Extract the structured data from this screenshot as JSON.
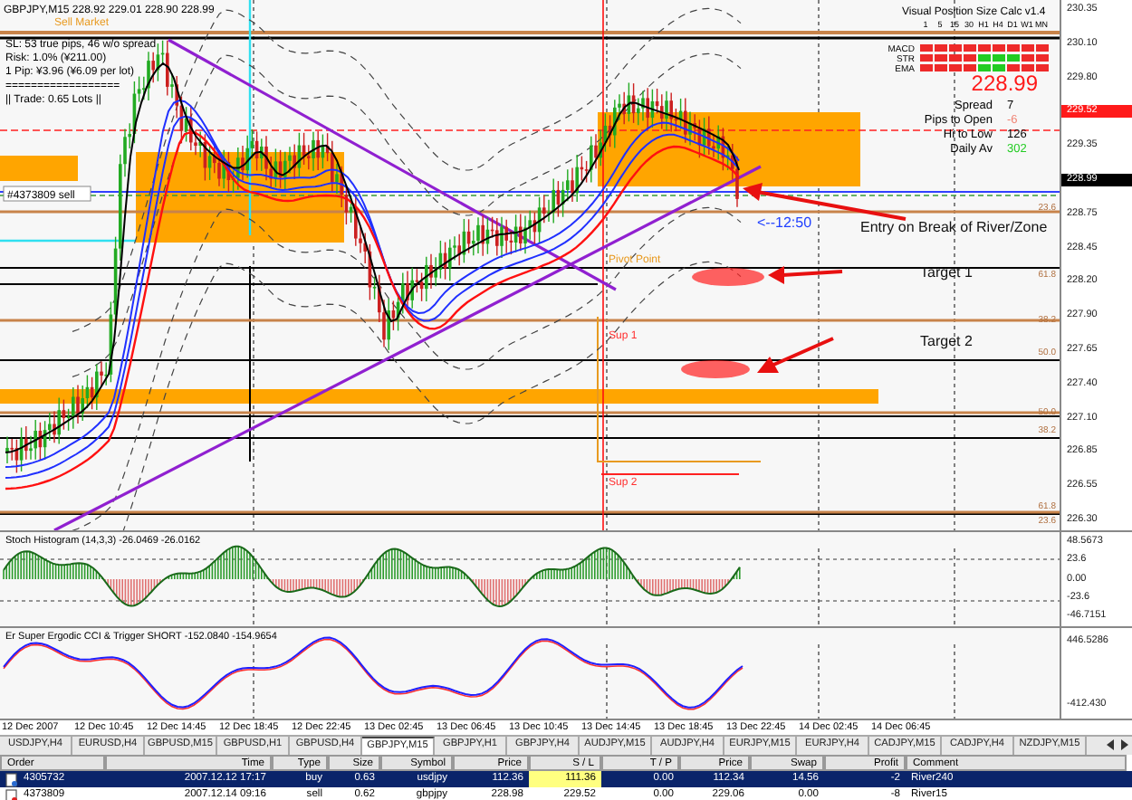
{
  "chart": {
    "title": "GBPJPY,M15  228.92 229.01 228.90 228.99",
    "order_label": "Sell Market",
    "info_lines": [
      "SL:    53 true pips, 46 w/o spread",
      "Risk:  1.0% (¥211.00)",
      "1 Pip:  ¥3.96 (¥6.09 per lot)",
      "==================",
      "||  Trade:  0.65 Lots  ||"
    ],
    "order_line_label": "#4373809 sell",
    "annotations": [
      {
        "kind": "time",
        "text": "<--12:50"
      },
      {
        "kind": "note",
        "text": "Entry on Break of River/Zone"
      },
      {
        "kind": "note",
        "text": "Target 1"
      },
      {
        "kind": "note",
        "text": "Target 2"
      },
      {
        "kind": "pivot",
        "text": "Pivot Point"
      },
      {
        "kind": "support",
        "text": "Sup 1"
      },
      {
        "kind": "support",
        "text": "Sup 2"
      }
    ],
    "fib_labels": [
      "23.6",
      "61.8",
      "38.2",
      "50.0",
      "50.0",
      "38.2",
      "61.8",
      "23.6"
    ],
    "price_axis": [
      {
        "text": "230.35",
        "kind": "tick"
      },
      {
        "text": "230.10",
        "kind": "tick"
      },
      {
        "text": "229.80",
        "kind": "tick"
      },
      {
        "text": "229.52",
        "kind": "alert"
      },
      {
        "text": "229.35",
        "kind": "tick"
      },
      {
        "text": "228.99",
        "kind": "current"
      },
      {
        "text": "228.75",
        "kind": "tick"
      },
      {
        "text": "228.45",
        "kind": "tick"
      },
      {
        "text": "228.20",
        "kind": "tick"
      },
      {
        "text": "227.90",
        "kind": "tick"
      },
      {
        "text": "227.65",
        "kind": "tick"
      },
      {
        "text": "227.40",
        "kind": "tick"
      },
      {
        "text": "227.10",
        "kind": "tick"
      },
      {
        "text": "226.85",
        "kind": "tick"
      },
      {
        "text": "226.55",
        "kind": "tick"
      },
      {
        "text": "226.30",
        "kind": "tick"
      }
    ]
  },
  "calc_panel": {
    "title": "Visual Position Size Calc v1.4",
    "timeframes": [
      "1",
      "5",
      "15",
      "30",
      "H1",
      "H4",
      "D1",
      "W1",
      "MN"
    ],
    "signals": [
      {
        "name": "MACD",
        "cells": [
          false,
          false,
          false,
          false,
          false,
          false,
          false,
          false,
          false
        ]
      },
      {
        "name": "STR",
        "cells": [
          false,
          false,
          false,
          false,
          true,
          true,
          true,
          false,
          false
        ]
      },
      {
        "name": "EMA",
        "cells": [
          false,
          false,
          false,
          false,
          true,
          true,
          false,
          false,
          false
        ]
      }
    ],
    "price": "228.99",
    "stats": [
      {
        "label": "Spread",
        "value": "7",
        "color": "#000000"
      },
      {
        "label": "Pips to Open",
        "value": "-6",
        "color": "#f08070"
      },
      {
        "label": "Hi to Low",
        "value": "126",
        "color": "#000000"
      },
      {
        "label": "Daily Av",
        "value": "302",
        "color": "#22cc22"
      }
    ]
  },
  "stoch": {
    "title": "Stoch Histogram (14,3,3) -26.0469 -26.0162",
    "axis": [
      "48.5673",
      "23.6",
      "0.00",
      "-23.6",
      "-46.7151"
    ]
  },
  "cci": {
    "title": "Er Super Ergodic CCI & Trigger SHORT -152.0840 -154.9654",
    "axis": [
      "446.5286",
      "-412.430"
    ]
  },
  "time_axis": [
    "12 Dec 2007",
    "12 Dec 10:45",
    "12 Dec 14:45",
    "12 Dec 18:45",
    "12 Dec 22:45",
    "13 Dec 02:45",
    "13 Dec 06:45",
    "13 Dec 10:45",
    "13 Dec 14:45",
    "13 Dec 18:45",
    "13 Dec 22:45",
    "14 Dec 02:45",
    "14 Dec 06:45"
  ],
  "tabs": [
    {
      "label": "USDJPY,H4",
      "selected": false
    },
    {
      "label": "EURUSD,H4",
      "selected": false
    },
    {
      "label": "GBPUSD,M15",
      "selected": false
    },
    {
      "label": "GBPUSD,H1",
      "selected": false
    },
    {
      "label": "GBPUSD,H4",
      "selected": false
    },
    {
      "label": "GBPJPY,M15",
      "selected": true
    },
    {
      "label": "GBPJPY,H1",
      "selected": false
    },
    {
      "label": "GBPJPY,H4",
      "selected": false
    },
    {
      "label": "AUDJPY,M15",
      "selected": false
    },
    {
      "label": "AUDJPY,H4",
      "selected": false
    },
    {
      "label": "EURJPY,M15",
      "selected": false
    },
    {
      "label": "EURJPY,H4",
      "selected": false
    },
    {
      "label": "CADJPY,M15",
      "selected": false
    },
    {
      "label": "CADJPY,H4",
      "selected": false
    },
    {
      "label": "NZDJPY,M15",
      "selected": false
    }
  ],
  "table": {
    "columns": [
      "Order",
      "Time",
      "Type",
      "Size",
      "Symbol",
      "Price",
      "S / L",
      "T / P",
      "Price",
      "Swap",
      "Profit",
      "Comment"
    ],
    "rows": [
      {
        "selected": true,
        "sl_highlighted": true,
        "cells": [
          "4305732",
          "2007.12.12 17:17",
          "buy",
          "0.63",
          "usdjpy",
          "112.36",
          "111.36",
          "0.00",
          "112.34",
          "14.56",
          "-2",
          "River240"
        ]
      },
      {
        "selected": false,
        "sl_highlighted": false,
        "cells": [
          "4373809",
          "2007.12.14 09:16",
          "sell",
          "0.62",
          "gbpjpy",
          "228.98",
          "229.52",
          "0.00",
          "229.06",
          "0.00",
          "-8",
          "River15"
        ]
      }
    ]
  }
}
